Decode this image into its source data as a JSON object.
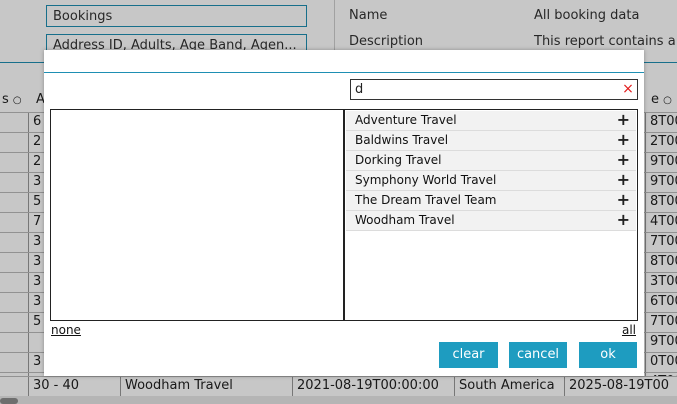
{
  "background": {
    "fields": [
      "Bookings",
      "Address ID, Adults, Age Band, Agen..."
    ],
    "properties": [
      {
        "label": "Name",
        "value": "All booking data"
      },
      {
        "label": "Description",
        "value": "This report contains a"
      }
    ],
    "grid": {
      "header_left": "s",
      "header_a": "A",
      "header_right": "e",
      "rows": [
        {
          "a": "6",
          "z": "8T00"
        },
        {
          "a": "2",
          "z": "2T00"
        },
        {
          "a": "2",
          "z": "9T00"
        },
        {
          "a": "3",
          "z": "9T00"
        },
        {
          "a": "5",
          "z": "8T00"
        },
        {
          "a": "7",
          "z": "4T00"
        },
        {
          "a": "3",
          "z": "7T00"
        },
        {
          "a": "3",
          "z": "8T00"
        },
        {
          "a": "3",
          "z": "3T00"
        },
        {
          "a": "3",
          "z": "6T00"
        },
        {
          "a": "5",
          "z": "7T00"
        },
        {
          "a": "",
          "z": "9T00"
        },
        {
          "a": "3",
          "z": "0T00"
        },
        {
          "a": "",
          "z": "4T00"
        }
      ],
      "last_row": [
        "30 - 40",
        "Woodham Travel",
        "2021-08-19T00:00:00",
        "South America",
        "2025-08-19T00"
      ]
    }
  },
  "modal": {
    "search": {
      "value": "d",
      "clear_glyph": "×"
    },
    "available_items": [
      "Adventure Travel",
      "Baldwins Travel",
      "Dorking Travel",
      "Symphony World Travel",
      "The Dream Travel Team",
      "Woodham Travel"
    ],
    "add_glyph": "+",
    "none_label": "none",
    "all_label": "all",
    "buttons": {
      "clear": "clear",
      "cancel": "cancel",
      "ok": "ok"
    }
  },
  "colors": {
    "accent": "#1e9cc0",
    "clear_x": "#e21b1b"
  }
}
